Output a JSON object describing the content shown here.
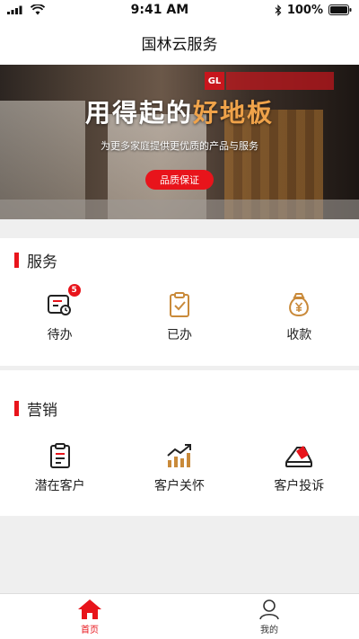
{
  "status_bar": {
    "time": "9:41 AM",
    "battery": "100%"
  },
  "nav": {
    "title": "国林云服务"
  },
  "banner": {
    "title_white": "用得起的",
    "title_orange": "好地板",
    "subtitle": "为更多家庭提供更优质的产品与服务",
    "button_label": "品质保证",
    "logo_text": "GL"
  },
  "service": {
    "title": "服务",
    "items": [
      {
        "label": "待办",
        "icon": "todo-icon",
        "badge": "5"
      },
      {
        "label": "已办",
        "icon": "done-clipboard-icon"
      },
      {
        "label": "收款",
        "icon": "money-bag-icon"
      }
    ]
  },
  "marketing": {
    "title": "营销",
    "items": [
      {
        "label": "潜在客户",
        "icon": "clipboard-list-icon"
      },
      {
        "label": "客户关怀",
        "icon": "trend-chart-icon"
      },
      {
        "label": "客户投诉",
        "icon": "complaint-envelope-icon"
      }
    ]
  },
  "tabs": [
    {
      "label": "首页",
      "icon": "home-icon"
    },
    {
      "label": "我的",
      "icon": "user-icon"
    }
  ],
  "colors": {
    "accent": "#e8141b",
    "icon_dark": "#222222",
    "icon_gold": "#c98a3a"
  }
}
